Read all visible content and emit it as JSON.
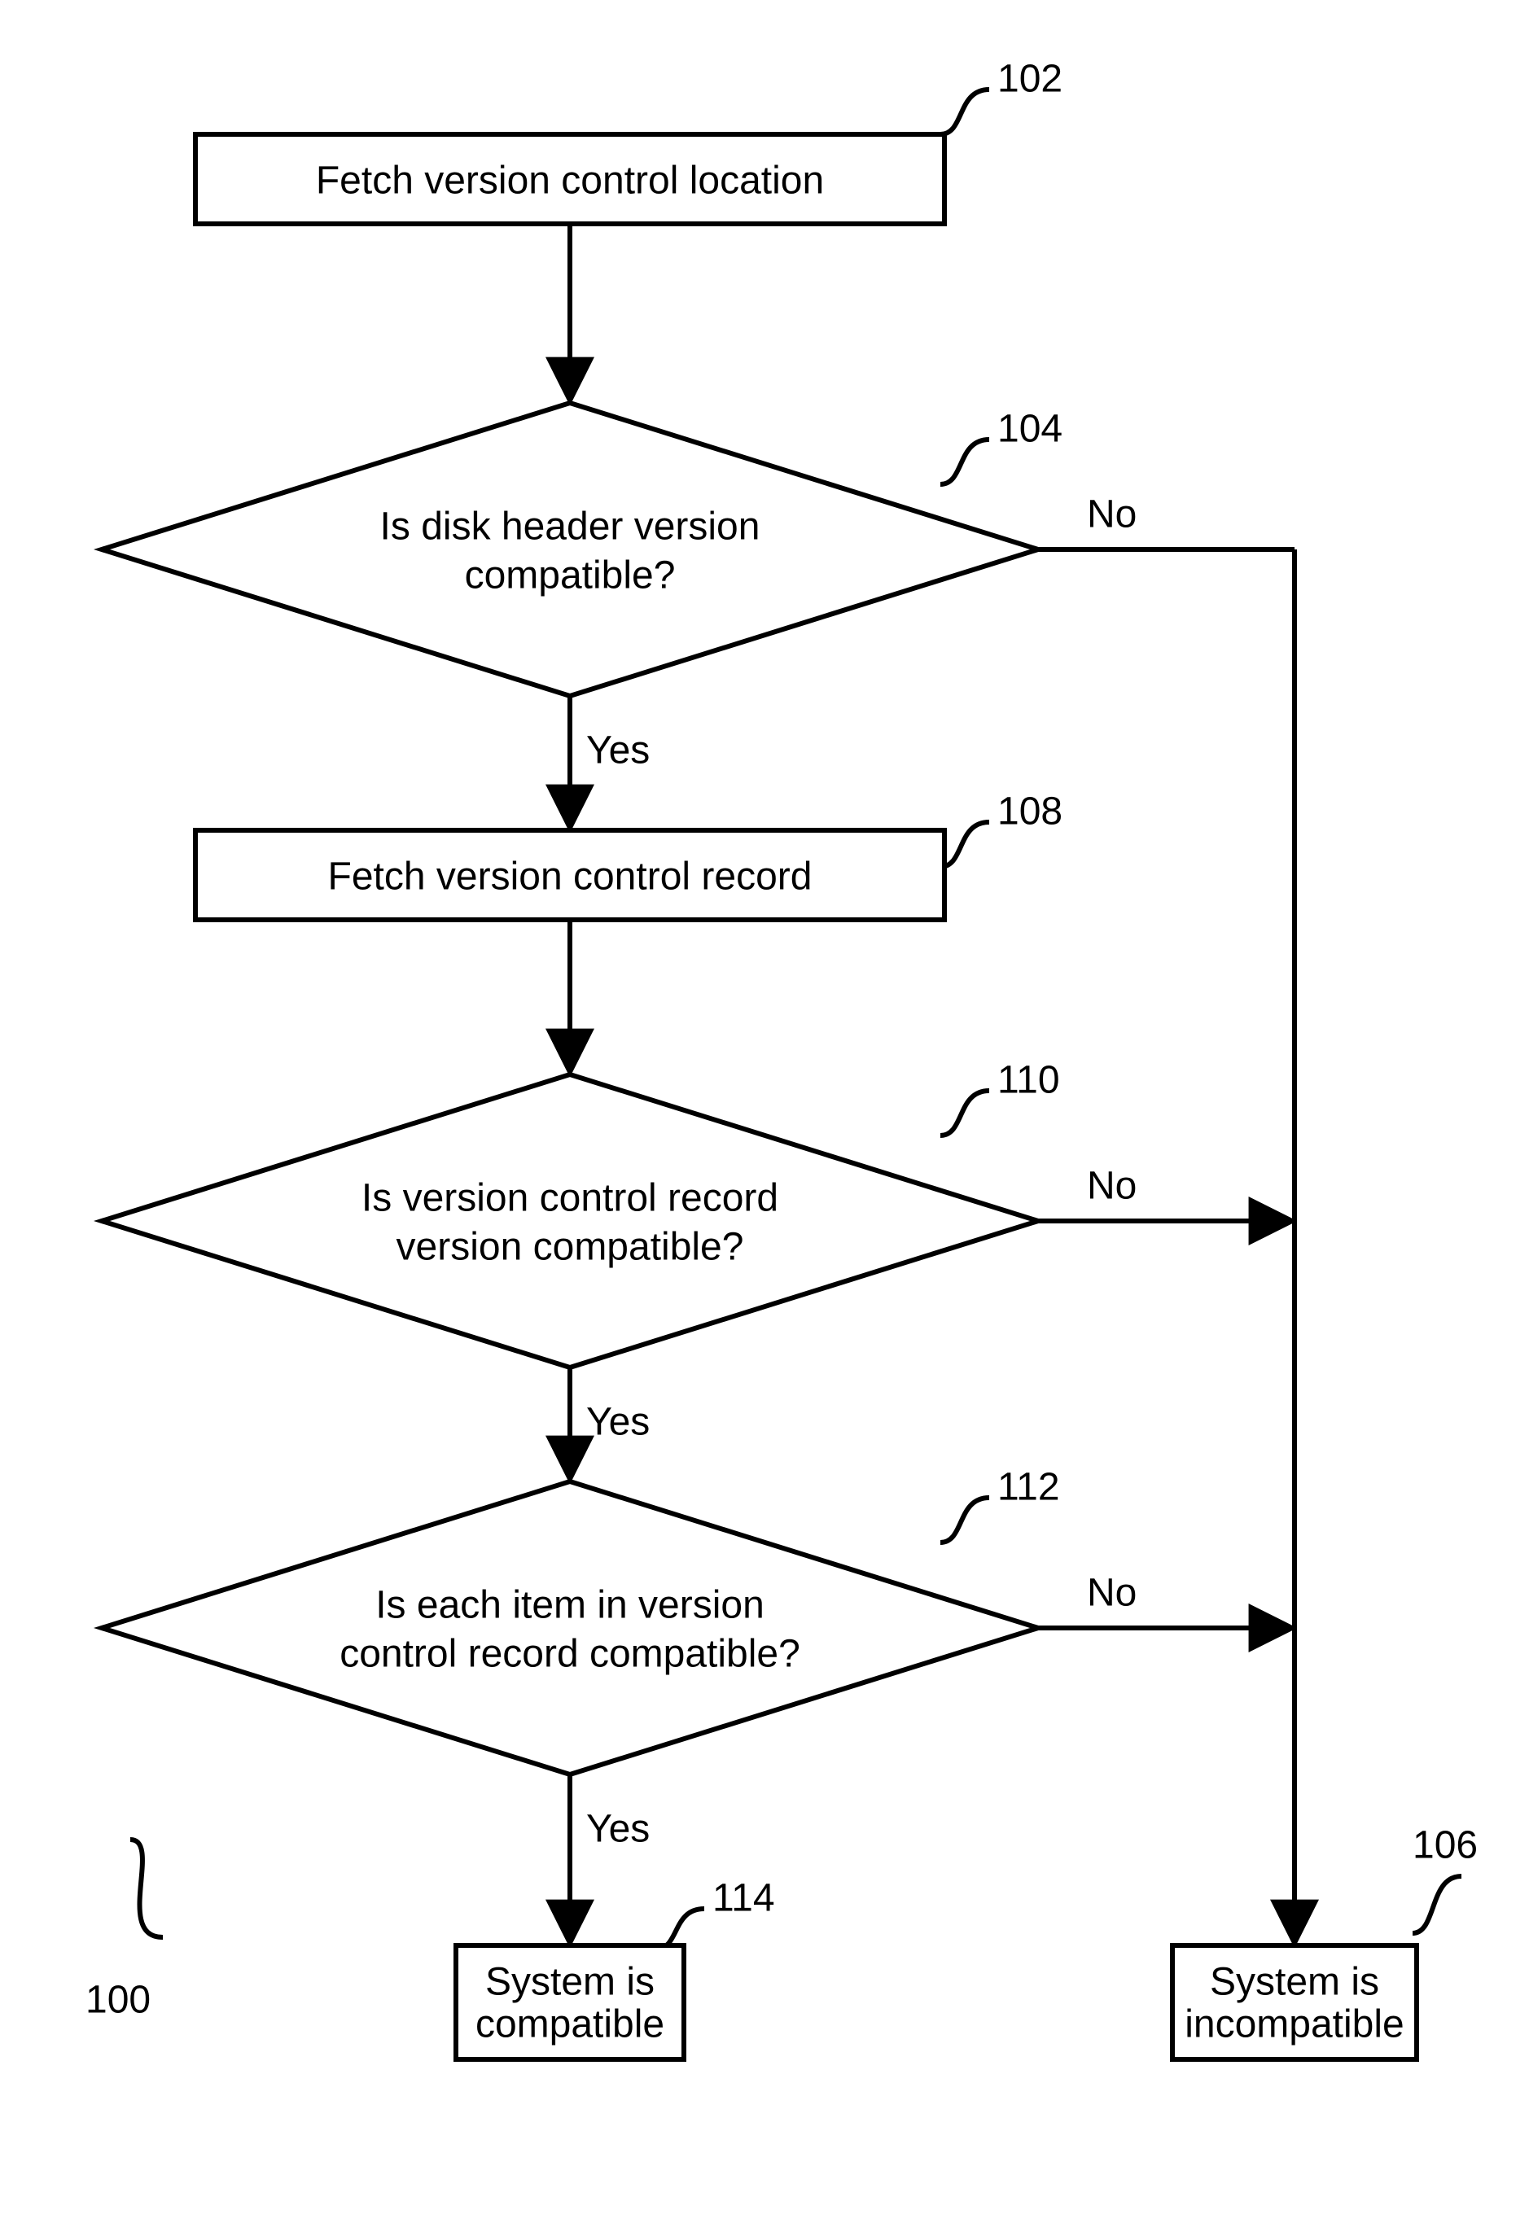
{
  "nodes": {
    "n102": {
      "label": "102",
      "text": "Fetch version control location"
    },
    "n104": {
      "label": "104",
      "text1": "Is disk header version",
      "text2": "compatible?"
    },
    "n108": {
      "label": "108",
      "text": "Fetch version control record"
    },
    "n110": {
      "label": "110",
      "text1": "Is version control record",
      "text2": "version compatible?"
    },
    "n112": {
      "label": "112",
      "text1": "Is each item in version",
      "text2": "control record compatible?"
    },
    "n114": {
      "label": "114",
      "text1": "System is",
      "text2": "compatible"
    },
    "n106": {
      "label": "106",
      "text1": "System is",
      "text2": "incompatible"
    }
  },
  "edges": {
    "yes": "Yes",
    "no": "No"
  },
  "figure_label": "100"
}
